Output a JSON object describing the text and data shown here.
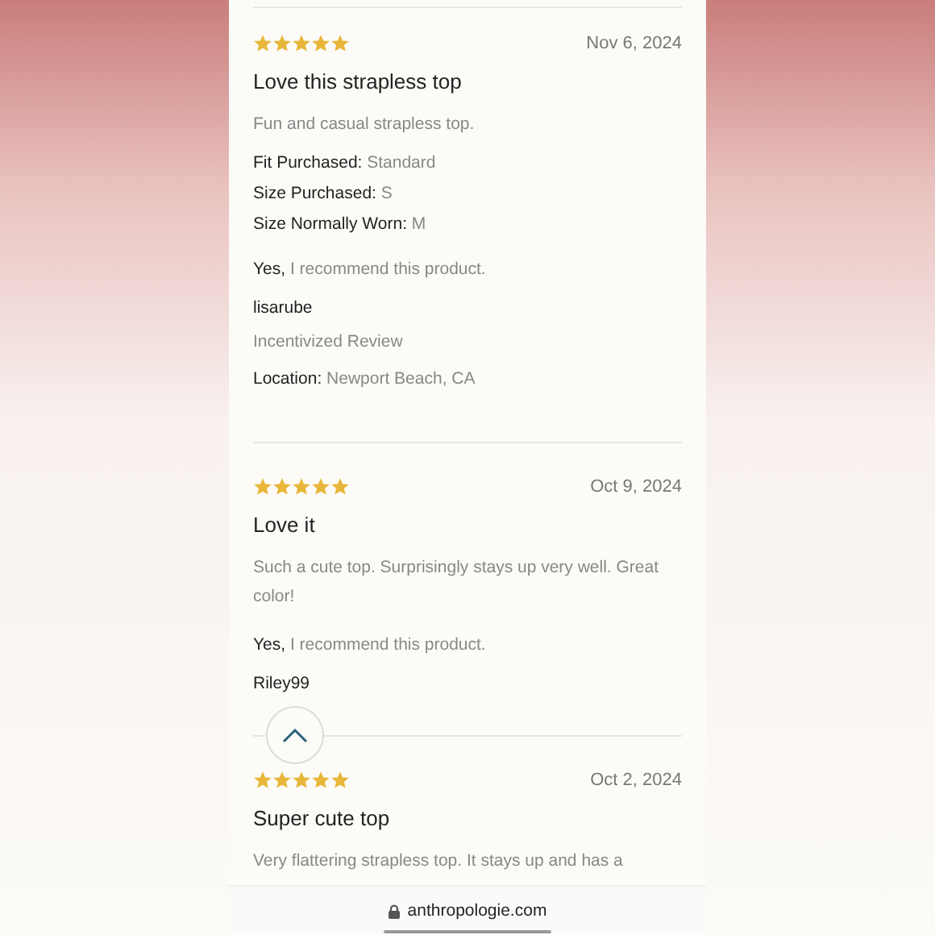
{
  "reviews": [
    {
      "stars": 5,
      "date": "Nov 6, 2024",
      "title": "Love this strapless top",
      "body": "Fun and casual strapless top.",
      "details": [
        "**Fit Purchased:** Standard",
        "**Size Purchased:** S",
        "**Size Normally Worn:** M"
      ],
      "recommend": "**Yes,** I recommend this product.",
      "username": "lisarube",
      "badge": "Incentivized Review",
      "location": "**Location:** Newport Beach, CA"
    },
    {
      "stars": 5,
      "date": "Oct 9, 2024",
      "title": "Love it",
      "body": "Such a cute top. Surprisingly stays up very well. Great color!",
      "recommend": "**Yes,** I recommend this product.",
      "username": "Riley99"
    },
    {
      "stars": 5,
      "date": "Oct 2, 2024",
      "title": "Super cute top",
      "body": "Very flattering strapless top. It stays up and has a"
    }
  ],
  "address_bar": {
    "url": "anthropologie.com"
  }
}
